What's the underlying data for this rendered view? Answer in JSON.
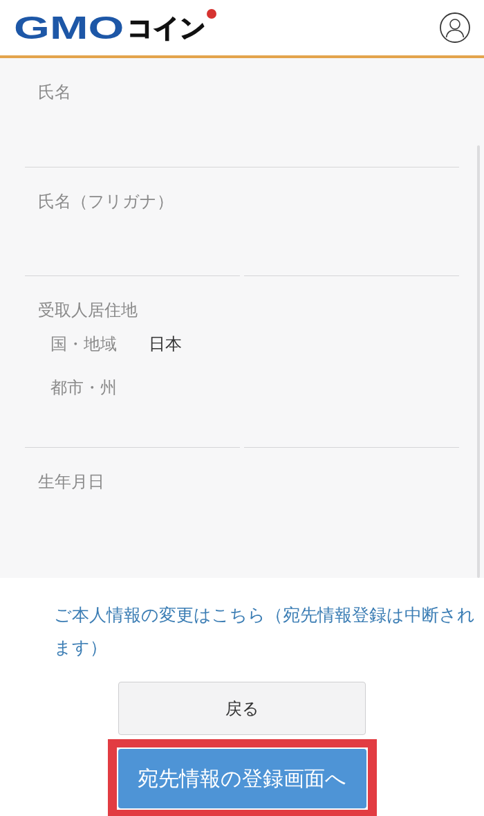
{
  "header": {
    "logo": {
      "primary": "GMO",
      "secondary": "コイン"
    }
  },
  "fields": [
    {
      "kind": "single",
      "label": "氏名"
    },
    {
      "kind": "split",
      "label": "氏名（フリガナ）"
    },
    {
      "kind": "address",
      "label": "受取人居住地",
      "rows": [
        {
          "label": "国・地域",
          "value": "日本"
        },
        {
          "label": "都市・州"
        }
      ]
    },
    {
      "kind": "plain",
      "label": "生年月日"
    }
  ],
  "change_link": "ご本人情報の変更はこちら（宛先情報登録は中断されます）",
  "buttons": [
    {
      "kind": "secondary",
      "label": "戻る",
      "highlighted": false
    },
    {
      "kind": "primary",
      "label": "宛先情報の登録画面へ",
      "highlighted": true
    }
  ]
}
